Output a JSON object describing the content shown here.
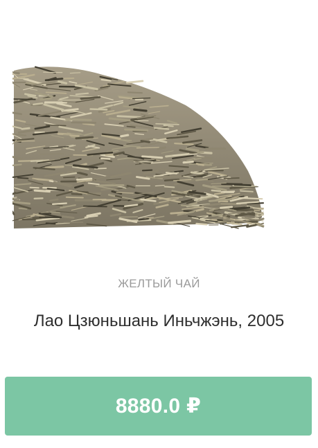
{
  "product": {
    "image_icon": "loose-tea-leaves-image",
    "category": "ЖЕЛТЫЙ ЧАЙ",
    "title": "Лао Цзюньшань Иньчжэнь, 2005",
    "price_label": "8880.0 ₽"
  },
  "colors": {
    "button_background": "#7cc6a4",
    "button_text": "#ffffff",
    "category_text": "#9a9a9a",
    "title_text": "#2e2e2e"
  }
}
